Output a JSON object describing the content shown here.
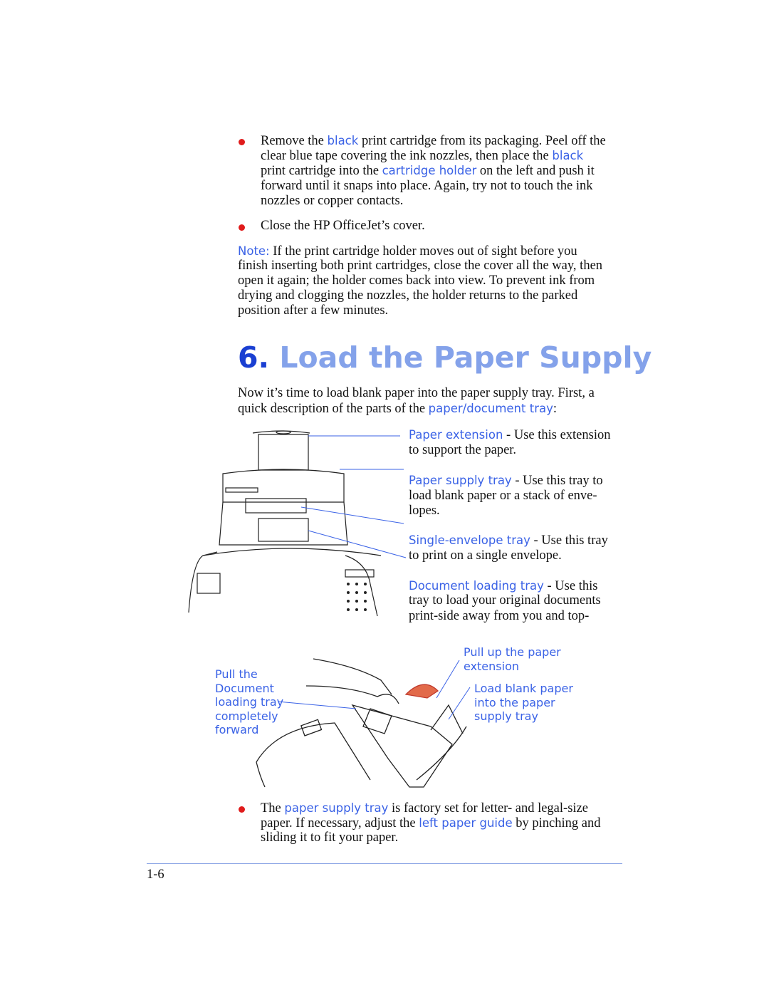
{
  "bullet1": {
    "t1": "Remove the ",
    "l1": "black",
    "t2": " print cartridge from its packaging. Peel off the",
    "t3": "clear blue tape covering the ink nozzles, then place the ",
    "l2": "black",
    "t4": "print cartridge into the ",
    "l3": "cartridge holder",
    "t5": " on the left and push it",
    "t6": "forward until it snaps into place. Again, try not to touch the ink",
    "t7": "nozzles or copper contacts."
  },
  "bullet2": "Close the HP OfficeJet’s cover.",
  "note": {
    "label": "Note:",
    "l1": " If the print cartridge holder moves out of sight before you",
    "l2": "finish inserting both print cartridges, close the cover all the way, then",
    "l3": "open it again; the holder comes back into view. To prevent ink from",
    "l4": "drying and clogging the nozzles, the holder returns to the parked",
    "l5": "position after a few minutes."
  },
  "heading": {
    "number": "6.",
    "title": "Load the Paper Supply"
  },
  "intro": {
    "l1": "Now it’s time to load blank paper into the paper supply tray. First, a",
    "l2a": "quick description of the parts of the ",
    "link": "paper/document tray",
    "l2b": ":"
  },
  "parts": [
    {
      "name": "Paper extension",
      "l1": " - Use this extension",
      "l2": "to support the paper.",
      "l3": ""
    },
    {
      "name": "Paper supply tray",
      "l1": " - Use this tray to",
      "l2": "load blank paper or a stack of enve-",
      "l3": "lopes."
    },
    {
      "name": "Single-envelope tray",
      "l1": " - Use this tray",
      "l2": "to print on a single envelope.",
      "l3": ""
    },
    {
      "name": "Document loading tray",
      "l1": " - Use this",
      "l2": "tray to load your original documents",
      "l3": "print-side away from you and top-"
    }
  ],
  "callouts": {
    "left": [
      "Pull the",
      "Document",
      "loading tray",
      "completely",
      "forward"
    ],
    "top": [
      "Pull up the paper",
      "extension"
    ],
    "right": [
      "Load blank paper",
      "into the paper",
      "supply tray"
    ]
  },
  "bullet3": {
    "t1": "The ",
    "l1": "paper supply tray",
    "t2": " is factory set for letter- and legal-size",
    "t3": "paper. If necessary, adjust the ",
    "l2": "left paper guide",
    "t4": " by pinching and",
    "t5": "sliding it to fit your paper."
  },
  "footer": {
    "page_number": "1-6"
  },
  "colors": {
    "link": "#3a62e6",
    "heading_number": "#1a3fd2",
    "heading_title": "#84a2ea",
    "bullet": "#e01b1b",
    "rule": "#8fa8e6"
  }
}
